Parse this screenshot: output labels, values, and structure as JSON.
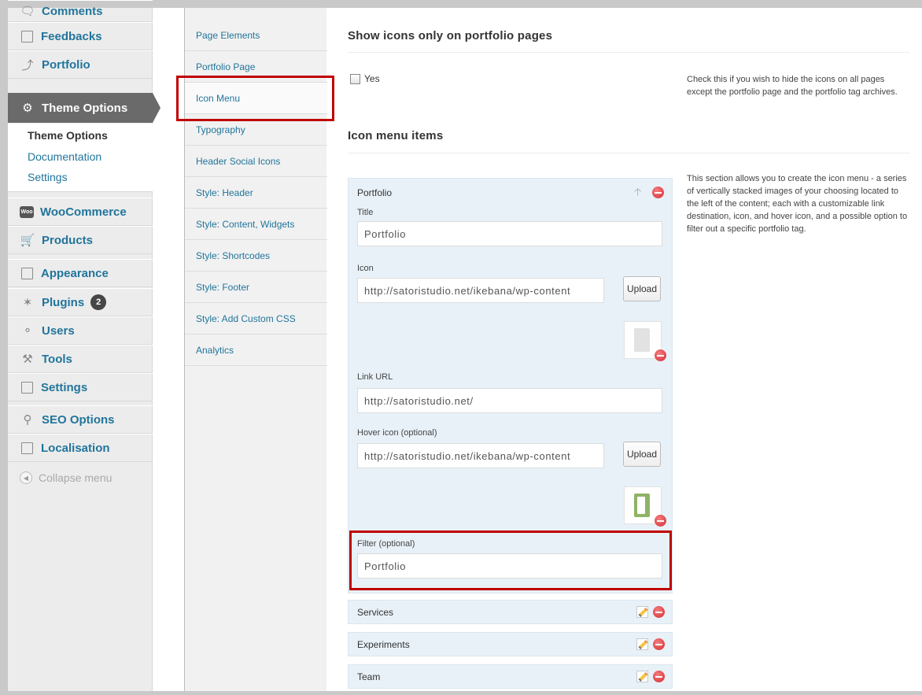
{
  "admin_menu": {
    "items": [
      {
        "label": "Comments",
        "icon": "comment-bubble-icon"
      },
      {
        "label": "Feedbacks",
        "icon": "feedback-icon"
      },
      {
        "label": "Portfolio",
        "icon": "pushpin-icon"
      },
      {
        "label": "Theme Options",
        "icon": "theme-options-icon"
      },
      {
        "label": "WooCommerce",
        "icon": "woo-icon",
        "icon_text": "Woo"
      },
      {
        "label": "Products",
        "icon": "cart-icon"
      },
      {
        "label": "Appearance",
        "icon": "appearance-icon"
      },
      {
        "label": "Plugins",
        "icon": "plugin-icon",
        "badge": "2"
      },
      {
        "label": "Users",
        "icon": "users-icon"
      },
      {
        "label": "Tools",
        "icon": "tools-icon"
      },
      {
        "label": "Settings",
        "icon": "settings-icon"
      },
      {
        "label": "SEO Options",
        "icon": "search-icon"
      },
      {
        "label": "Localisation",
        "icon": "localisation-icon"
      }
    ],
    "submenu": [
      "Theme Options",
      "Documentation",
      "Settings"
    ],
    "collapse_label": "Collapse menu"
  },
  "options_nav": {
    "items": [
      "Page Elements",
      "Portfolio Page",
      "Icon Menu",
      "Typography",
      "Header Social Icons",
      "Style: Header",
      "Style: Content, Widgets",
      "Style: Shortcodes",
      "Style: Footer",
      "Style: Add Custom CSS",
      "Analytics"
    ],
    "selected": "Icon Menu"
  },
  "content": {
    "section1": {
      "title": "Show icons only on portfolio pages",
      "checkbox_label": "Yes",
      "checked": false,
      "description": "Check this if you wish to hide the icons on all pages except the portfolio page and the portfolio tag archives."
    },
    "section2": {
      "title": "Icon menu items",
      "description": "This section allows you to create the icon menu - a series of vertically stacked images of your choosing located to the left of the content; each with a customizable link destination, icon, and hover icon, and a possible option to filter out a specific portfolio tag."
    },
    "expanded_item": {
      "heading": "Portfolio",
      "title_label": "Title",
      "title_value": "Portfolio",
      "icon_label": "Icon",
      "icon_value": "http://satoristudio.net/ikebana/wp-content",
      "upload_label": "Upload",
      "link_label": "Link URL",
      "link_value": "http://satoristudio.net/",
      "hover_label": "Hover icon (optional)",
      "hover_value": "http://satoristudio.net/ikebana/wp-content",
      "filter_label": "Filter (optional)",
      "filter_value": "Portfolio"
    },
    "collapsed_items": [
      "Services",
      "Experiments",
      "Team"
    ]
  },
  "colors": {
    "link": "#21759b",
    "current_menu_bg": "#6a6a6a",
    "highlight_box": "#c00000",
    "panel_bg": "#e8f1f8",
    "remove_button": "#d6292f"
  }
}
